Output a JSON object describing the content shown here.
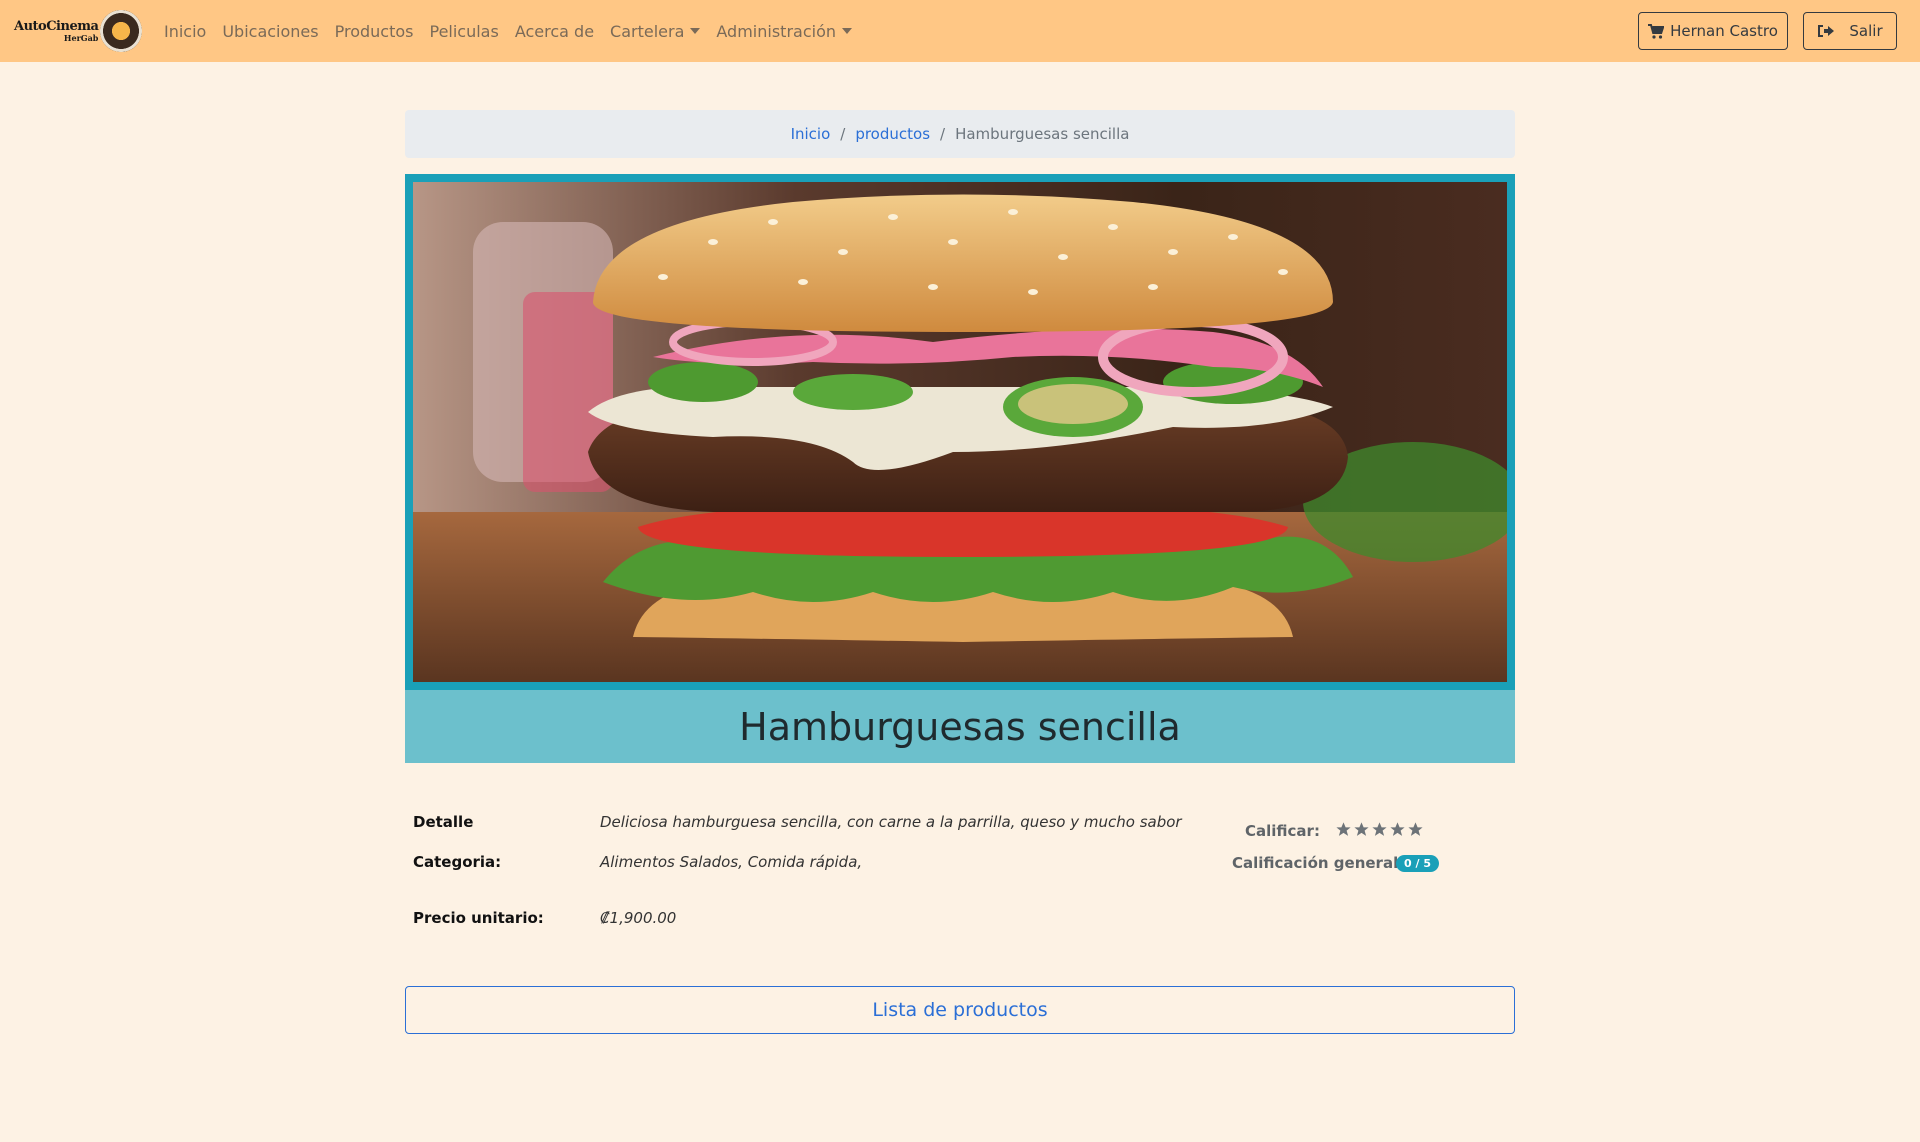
{
  "navbar": {
    "brand_title": "AutoCinema",
    "brand_sub": "HerGab",
    "links": [
      "Inicio",
      "Ubicaciones",
      "Productos",
      "Peliculas",
      "Acerca de"
    ],
    "dropdowns": [
      "Cartelera",
      "Administración"
    ],
    "user_label": "Hernan Castro",
    "exit_label": "Salir"
  },
  "breadcrumb": {
    "home": "Inicio",
    "section": "productos",
    "current": "Hamburguesas sencilla"
  },
  "product": {
    "title": "Hamburguesas sencilla",
    "detail_label": "Detalle",
    "detail_value": "Deliciosa hamburguesa sencilla, con carne a la parrilla, queso y mucho sabor",
    "category_label": "Categoria:",
    "category_value": "Alimentos Salados, Comida rápida,",
    "price_label": "Precio unitario:",
    "price_value": "₡1,900.00"
  },
  "rating": {
    "rate_label": "Calificar:",
    "overall_label": "Calificación general:",
    "overall_value": "0 / 5",
    "stars": 5
  },
  "actions": {
    "list_label": "Lista de productos"
  },
  "colors": {
    "navbar": "#ffc785",
    "background": "#fdf2e4",
    "card_border": "#1aa0b8",
    "title_bar": "#6cc0cc",
    "link": "#2b6fd6"
  }
}
